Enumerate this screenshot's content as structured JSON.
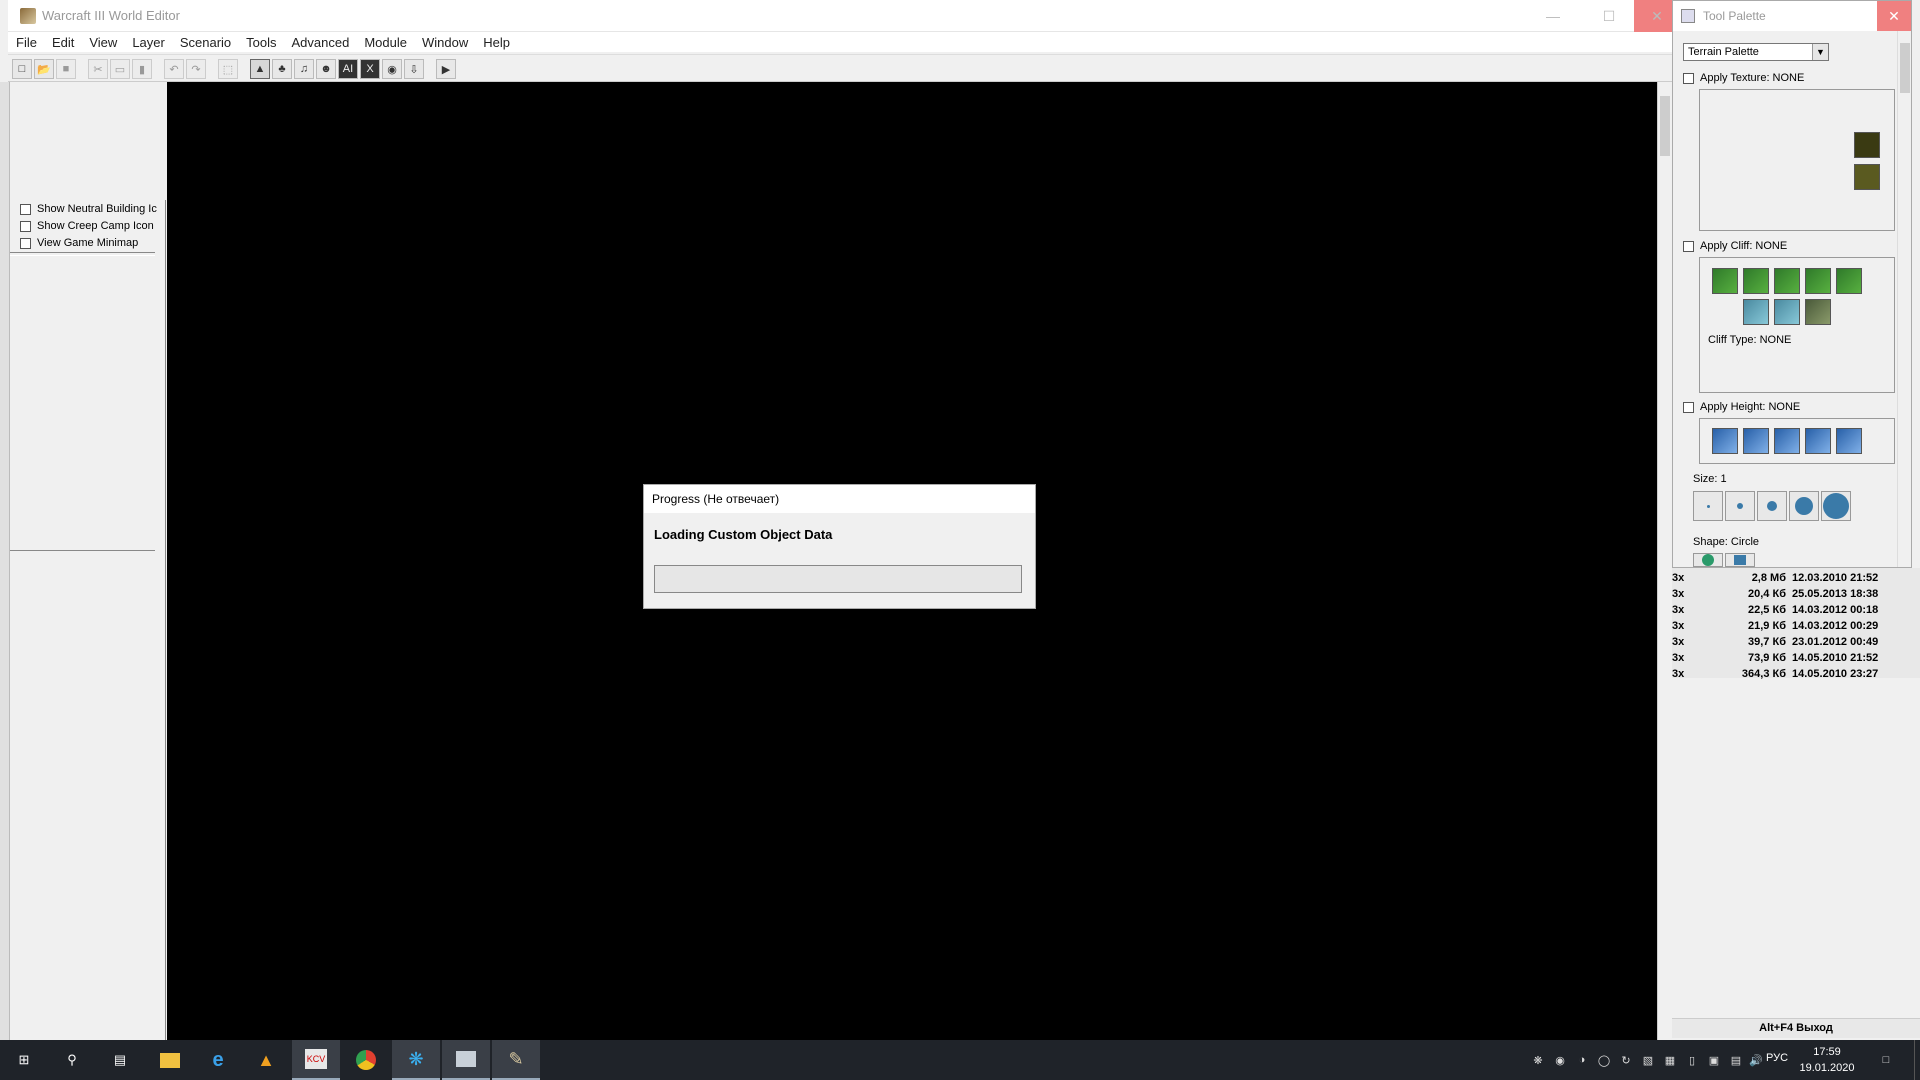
{
  "main_window": {
    "title": "Warcraft III World Editor",
    "menu": [
      "File",
      "Edit",
      "View",
      "Layer",
      "Scenario",
      "Tools",
      "Advanced",
      "Module",
      "Window",
      "Help"
    ],
    "toolbar_icons": [
      "new-file-icon",
      "open-file-icon",
      "save-icon",
      "cut-icon",
      "copy-icon",
      "paste-icon",
      "undo-icon",
      "redo-icon",
      "select-icon",
      "terrain-editor-icon",
      "doodad-editor-icon",
      "sound-editor-icon",
      "unit-editor-icon",
      "ai-editor-icon",
      "trigger-editor-icon",
      "object-editor-icon",
      "import-icon",
      "test-map-icon"
    ]
  },
  "left_panel": {
    "options": [
      {
        "label": "Show Neutral Building Ic",
        "checked": false
      },
      {
        "label": "Show Creep Camp Icon",
        "checked": false
      },
      {
        "label": "View Game Minimap",
        "checked": false
      }
    ]
  },
  "progress_dialog": {
    "title": "Progress (Не отвечает)",
    "message": "Loading Custom Object Data",
    "progress": 0
  },
  "tool_palette": {
    "title": "Tool Palette",
    "palette_selected": "Terrain Palette",
    "apply_texture": "Apply Texture: NONE",
    "apply_cliff": "Apply Cliff: NONE",
    "cliff_type": "Cliff Type: NONE",
    "apply_height": "Apply Height: NONE",
    "size": "Size: 1",
    "shape": "Shape: Circle"
  },
  "file_list": [
    {
      "fmt": "3x",
      "size": "2,8 Мб",
      "date": "12.03.2010 21:52"
    },
    {
      "fmt": "3x",
      "size": "20,4 Кб",
      "date": "25.05.2013 18:38"
    },
    {
      "fmt": "3x",
      "size": "22,5 Кб",
      "date": "14.03.2012 00:18"
    },
    {
      "fmt": "3x",
      "size": "21,9 Кб",
      "date": "14.03.2012 00:29"
    },
    {
      "fmt": "3x",
      "size": "39,7 Кб",
      "date": "23.01.2012 00:49"
    },
    {
      "fmt": "3x",
      "size": "73,9 Кб",
      "date": "14.05.2010 21:52"
    },
    {
      "fmt": "3x",
      "size": "364,3 Кб",
      "date": "14.05.2010 23:27"
    }
  ],
  "hint_bar": "Alt+F4 Выход",
  "taskbar": {
    "language": "РУС",
    "time": "17:59",
    "date": "19.01.2020"
  }
}
